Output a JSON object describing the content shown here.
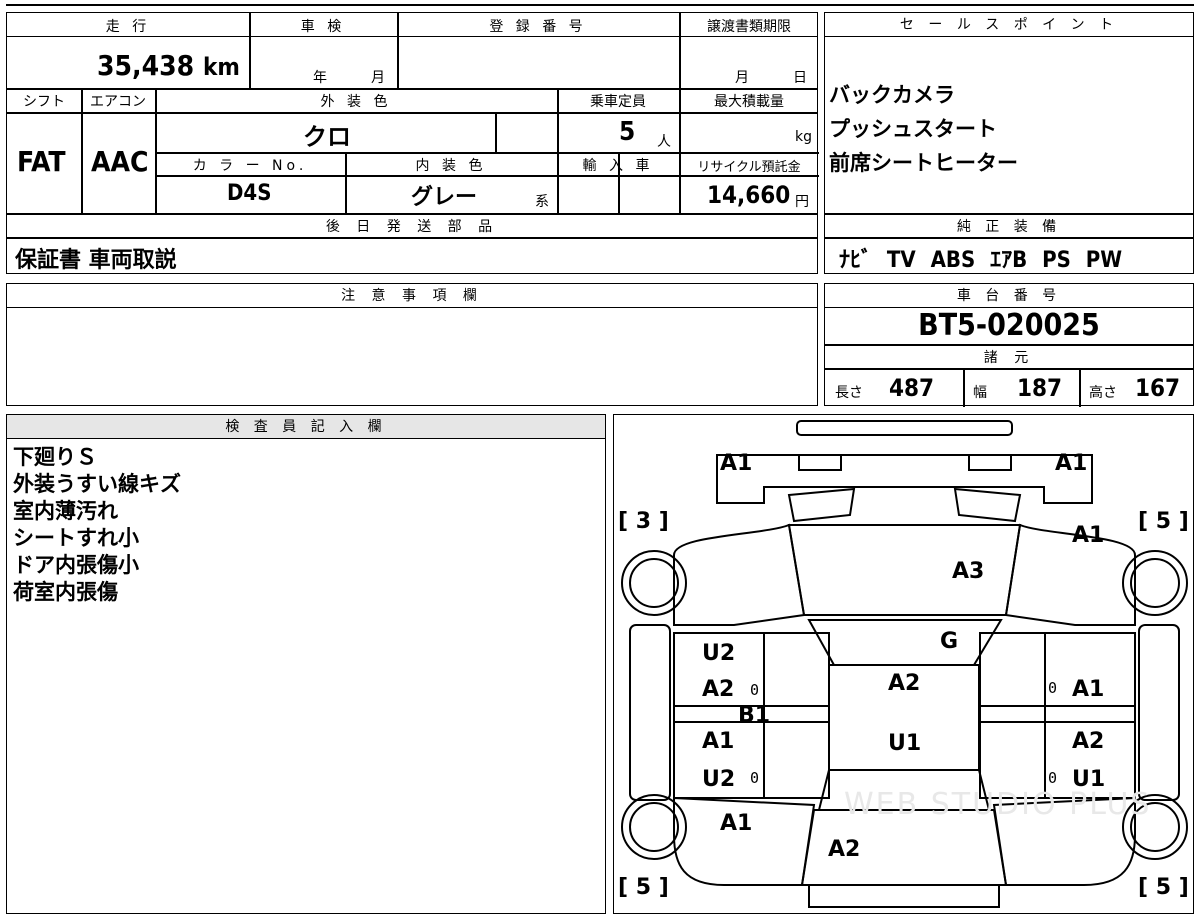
{
  "mileage": {
    "label": "走 行",
    "value": "35,438",
    "unit": "km"
  },
  "inspection": {
    "label": "車 検",
    "year_unit": "年",
    "month_unit": "月"
  },
  "registration": {
    "label": "登 録 番 号",
    "value": ""
  },
  "transfer_deadline": {
    "label": "譲渡書類期限",
    "month_unit": "月",
    "day_unit": "日"
  },
  "sales_points": {
    "label": "セ ー ル ス ポ イ ン ト",
    "items": [
      "バックカメラ",
      "プッシュスタート",
      "前席シートヒーター"
    ]
  },
  "shift": {
    "label": "シフト",
    "value": "FAT"
  },
  "aircon": {
    "label": "エアコン",
    "value": "AAC"
  },
  "exterior_color": {
    "label": "外 装 色",
    "value": "クロ"
  },
  "capacity": {
    "label": "乗車定員",
    "value": "5",
    "unit": "人"
  },
  "max_load": {
    "label": "最大積載量",
    "unit": "kg"
  },
  "color_no": {
    "label": "カ ラ ー No.",
    "value": "D4S"
  },
  "interior_color": {
    "label": "内 装 色",
    "value": "グレー",
    "suffix": "系"
  },
  "import": {
    "label": "輸 入 車"
  },
  "recycle": {
    "label": "リサイクル預託金",
    "value": "14,660",
    "unit": "円"
  },
  "later_parts": {
    "label": "後 日 発 送 部 品",
    "value": "保証書 車両取説"
  },
  "genuine_equipment": {
    "label": "純 正 装 備",
    "value": "ﾅﾋﾞ TV ABS ｴｱB PS PW"
  },
  "notes": {
    "label": "注 意 事 項 欄"
  },
  "chassis": {
    "label": "車 台 番 号",
    "value": "BT5-020025"
  },
  "specs": {
    "label": "諸 元",
    "length_label": "長さ",
    "length": "487",
    "width_label": "幅",
    "width": "187",
    "height_label": "高さ",
    "height": "167"
  },
  "inspector": {
    "label": "検 査 員 記 入 欄",
    "lines": [
      "下廻りＳ",
      "外装うすい線キズ",
      "室内薄汚れ",
      "シートすれ小",
      "ドア内張傷小",
      "荷室内張傷"
    ]
  },
  "diagram": {
    "marks": {
      "front_left": "A1",
      "front_right": "A1",
      "bracket_left_front": "3",
      "bracket_right_front": "5",
      "fender_right": "A1",
      "hood": "A3",
      "windshield": "G",
      "door_left_front_top": "U2",
      "door_left_front_bot": "A2",
      "pillar_left": "B1",
      "door_left_rear_top": "A1",
      "door_left_rear_bot": "U2",
      "roof_top": "A2",
      "roof_bot": "U1",
      "door_right_front": "A1",
      "door_right_rear_top": "A2",
      "door_right_rear_bot": "U1",
      "quarter_left": "A1",
      "trunk": "A2",
      "bracket_left_rear": "5",
      "bracket_right_rear": "5",
      "zero": "0"
    },
    "watermark": "WEB STUDIO PLUS"
  }
}
